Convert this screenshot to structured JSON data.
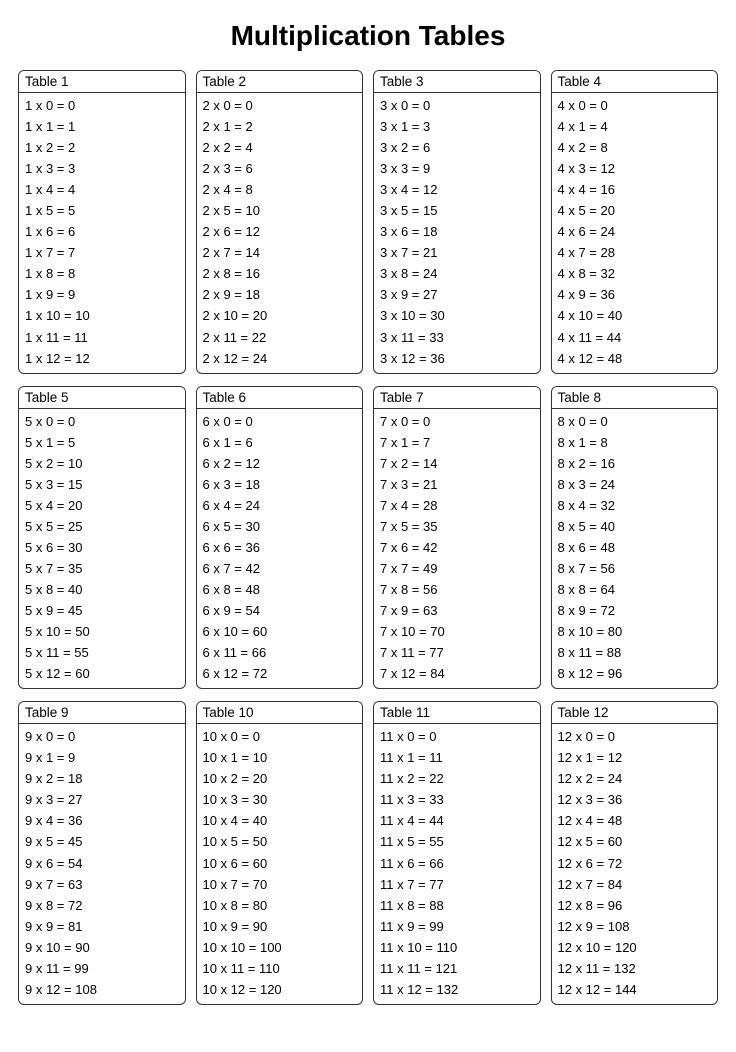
{
  "title": "Multiplication Tables",
  "tables": [
    {
      "label": "Table 1",
      "multiplier": 1,
      "rows": [
        "1 x 0 = 0",
        "1 x 1 = 1",
        "1 x 2 = 2",
        "1 x 3 = 3",
        "1 x 4 = 4",
        "1 x 5 = 5",
        "1 x 6 = 6",
        "1 x 7 = 7",
        "1 x 8 = 8",
        "1 x 9 = 9",
        "1 x 10 = 10",
        "1 x 11 = 11",
        "1 x 12 = 12"
      ]
    },
    {
      "label": "Table 2",
      "multiplier": 2,
      "rows": [
        "2 x 0 = 0",
        "2 x 1 = 2",
        "2 x 2 = 4",
        "2 x 3 = 6",
        "2 x 4 = 8",
        "2 x 5 = 10",
        "2 x 6 = 12",
        "2 x 7 = 14",
        "2 x 8 = 16",
        "2 x 9 = 18",
        "2 x 10 = 20",
        "2 x 11 = 22",
        "2 x 12 = 24"
      ]
    },
    {
      "label": "Table 3",
      "multiplier": 3,
      "rows": [
        "3 x 0 = 0",
        "3 x 1 = 3",
        "3 x 2 = 6",
        "3 x 3 = 9",
        "3 x 4 = 12",
        "3 x 5 = 15",
        "3 x 6 = 18",
        "3 x 7 = 21",
        "3 x 8 = 24",
        "3 x 9 = 27",
        "3 x 10 = 30",
        "3 x 11 = 33",
        "3 x 12 = 36"
      ]
    },
    {
      "label": "Table 4",
      "multiplier": 4,
      "rows": [
        "4 x 0 = 0",
        "4 x 1 = 4",
        "4 x 2 = 8",
        "4 x 3 = 12",
        "4 x 4 = 16",
        "4 x 5 = 20",
        "4 x 6 = 24",
        "4 x 7 = 28",
        "4 x 8 = 32",
        "4 x 9 = 36",
        "4 x 10 = 40",
        "4 x 11 = 44",
        "4 x 12 = 48"
      ]
    },
    {
      "label": "Table 5",
      "multiplier": 5,
      "rows": [
        "5 x 0 = 0",
        "5 x 1 = 5",
        "5 x 2 = 10",
        "5 x 3 = 15",
        "5 x 4 = 20",
        "5 x 5 = 25",
        "5 x 6 = 30",
        "5 x 7 = 35",
        "5 x 8 = 40",
        "5 x 9 = 45",
        "5 x 10 = 50",
        "5 x 11 = 55",
        "5 x 12 = 60"
      ]
    },
    {
      "label": "Table 6",
      "multiplier": 6,
      "rows": [
        "6 x 0 = 0",
        "6 x 1 = 6",
        "6 x 2 = 12",
        "6 x 3 = 18",
        "6 x 4 = 24",
        "6 x 5 = 30",
        "6 x 6 = 36",
        "6 x 7 = 42",
        "6 x 8 = 48",
        "6 x 9 = 54",
        "6 x 10 = 60",
        "6 x 11 = 66",
        "6 x 12 = 72"
      ]
    },
    {
      "label": "Table 7",
      "multiplier": 7,
      "rows": [
        "7 x 0 = 0",
        "7 x 1 = 7",
        "7 x 2 = 14",
        "7 x 3 = 21",
        "7 x 4 = 28",
        "7 x 5 = 35",
        "7 x 6 = 42",
        "7 x 7 = 49",
        "7 x 8 = 56",
        "7 x 9 = 63",
        "7 x 10 = 70",
        "7 x 11 = 77",
        "7 x 12 = 84"
      ]
    },
    {
      "label": "Table 8",
      "multiplier": 8,
      "rows": [
        "8 x 0 = 0",
        "8 x 1 = 8",
        "8 x 2 = 16",
        "8 x 3 = 24",
        "8 x 4 = 32",
        "8 x 5 = 40",
        "8 x 6 = 48",
        "8 x 7 = 56",
        "8 x 8 = 64",
        "8 x 9 = 72",
        "8 x 10 = 80",
        "8 x 11 = 88",
        "8 x 12 = 96"
      ]
    },
    {
      "label": "Table 9",
      "multiplier": 9,
      "rows": [
        "9 x 0 = 0",
        "9 x 1 = 9",
        "9 x 2 = 18",
        "9 x 3 = 27",
        "9 x 4 = 36",
        "9 x 5 = 45",
        "9 x 6 = 54",
        "9 x 7 = 63",
        "9 x 8 = 72",
        "9 x 9 = 81",
        "9 x 10 = 90",
        "9 x 11 = 99",
        "9 x 12 = 108"
      ]
    },
    {
      "label": "Table 10",
      "multiplier": 10,
      "rows": [
        "10 x 0 = 0",
        "10 x 1 = 10",
        "10 x 2 = 20",
        "10 x 3 = 30",
        "10 x 4 = 40",
        "10 x 5 = 50",
        "10 x 6 = 60",
        "10 x 7 = 70",
        "10 x 8 = 80",
        "10 x 9 = 90",
        "10 x 10 = 100",
        "10 x 11 = 110",
        "10 x 12 = 120"
      ]
    },
    {
      "label": "Table 11",
      "multiplier": 11,
      "rows": [
        "11 x 0 = 0",
        "11 x 1 = 11",
        "11 x 2 = 22",
        "11 x 3 = 33",
        "11 x 4 = 44",
        "11 x 5 = 55",
        "11 x 6 = 66",
        "11 x 7 = 77",
        "11 x 8 = 88",
        "11 x 9 = 99",
        "11 x 10 = 110",
        "11 x 11 = 121",
        "11 x 12 = 132"
      ]
    },
    {
      "label": "Table 12",
      "multiplier": 12,
      "rows": [
        "12 x 0 = 0",
        "12 x 1 = 12",
        "12 x 2 = 24",
        "12 x 3 = 36",
        "12 x 4 = 48",
        "12 x 5 = 60",
        "12 x 6 = 72",
        "12 x 7 = 84",
        "12 x 8 = 96",
        "12 x 9 = 108",
        "12 x 10 = 120",
        "12 x 11 = 132",
        "12 x 12 = 144"
      ]
    }
  ]
}
